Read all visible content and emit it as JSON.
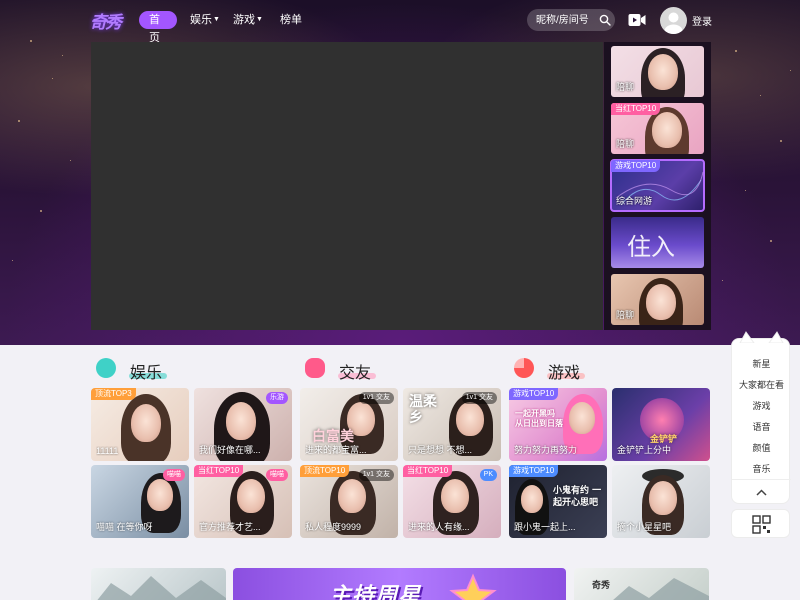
{
  "nav": {
    "logo": "奇秀",
    "home": "首页",
    "entertainment": "娱乐",
    "games": "游戏",
    "ranking": "榜单",
    "search_placeholder": "昵称/房间号",
    "login": "登录"
  },
  "side_thumbs": [
    {
      "tag": "",
      "label": "陪聊"
    },
    {
      "tag": "当红TOP10",
      "label": "陪聊"
    },
    {
      "tag": "游戏TOP10",
      "label": "综合网游"
    },
    {
      "tag": "",
      "label": ""
    },
    {
      "tag": "",
      "label": "陪聊"
    }
  ],
  "categories": [
    {
      "title": "娱乐",
      "color": "#3fd1c7"
    },
    {
      "title": "交友",
      "color": "#ff5a8a"
    },
    {
      "title": "游戏",
      "color": "#ff5656"
    }
  ],
  "cards": {
    "c1": {
      "tag": "顶流TOP3",
      "title": "11111"
    },
    "c2": {
      "tag": "",
      "title": "我们好像在哪...",
      "badge": "乐游"
    },
    "c3": {
      "tag": "",
      "title": "进来的都宝富...",
      "badge": "1v1 交友",
      "art": "白富美"
    },
    "c4": {
      "tag": "",
      "title": "只是想想 不想...",
      "badge": "1v1 交友",
      "art": "温柔乡"
    },
    "c5": {
      "tag": "游戏TOP10",
      "title": "努力努力再努力",
      "art": "一起开黑吗 从日出到日落"
    },
    "c6": {
      "tag": "",
      "title": "金铲铲上分中",
      "art": "金铲铲"
    },
    "c7": {
      "tag": "",
      "title": "喵喵 在等你呀",
      "badge": "喵喵"
    },
    "c8": {
      "tag": "当红TOP10",
      "title": "官方推荐才艺...",
      "badge": "喵喵"
    },
    "c9": {
      "tag": "顶流TOP10",
      "title": "私人程度9999",
      "badge": "1v1 交友"
    },
    "c10": {
      "tag": "当红TOP10",
      "title": "进来的人有缘...",
      "badge": "PK"
    },
    "c11": {
      "tag": "游戏TOP10",
      "title": "跟小鬼一起上...",
      "art": "小鬼有约 一起开心思吧"
    },
    "c12": {
      "tag": "",
      "title": "摘个小星星吧"
    }
  },
  "float_menu": {
    "items": [
      "新星",
      "大家都在看",
      "游戏",
      "语音",
      "颜值",
      "音乐"
    ]
  },
  "bottom": {
    "banner": "主持周星",
    "right_logo": "奇秀"
  },
  "colors": {
    "accent": "#a356ff",
    "tag_orange": "#ff9f3a",
    "tag_pink": "#ff5fa2",
    "tag_purple": "#7e67ff",
    "tag_blue": "#4d8cff"
  }
}
